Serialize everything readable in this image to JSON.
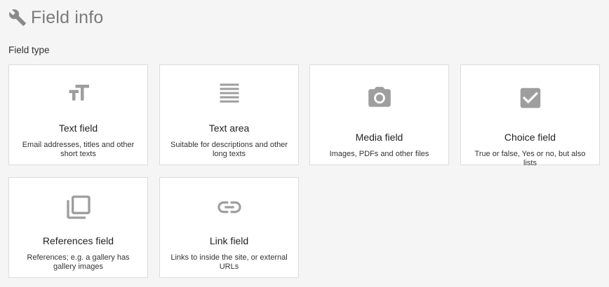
{
  "header": {
    "title": "Field info",
    "icon": "wrench-icon"
  },
  "section": {
    "label": "Field type"
  },
  "colors": {
    "icon_gray": "#9e9e9e",
    "title_gray": "#7a7a7a",
    "background": "#f5f5f5",
    "card_border": "#dcdcdc"
  },
  "cards": [
    {
      "icon": "text-size-icon",
      "name": "Text field",
      "description": "Email addresses, titles and other short texts"
    },
    {
      "icon": "text-lines-icon",
      "name": "Text area",
      "description": "Suitable for descriptions and other long texts"
    },
    {
      "icon": "camera-icon",
      "name": "Media field",
      "description": "Images, PDFs and other files"
    },
    {
      "icon": "checkbox-icon",
      "name": "Choice field",
      "description": "True or false, Yes or no, but also lists"
    },
    {
      "icon": "library-icon",
      "name": "References field",
      "description": "References; e.g. a gallery has gallery images"
    },
    {
      "icon": "link-icon",
      "name": "Link field",
      "description": "Links to inside the site, or external URLs"
    }
  ]
}
